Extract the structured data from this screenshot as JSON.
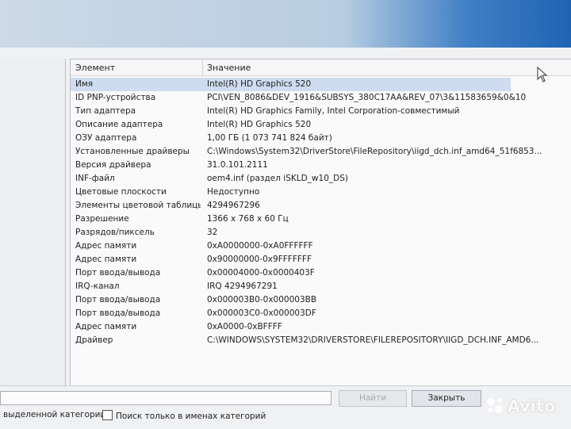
{
  "list": {
    "col_element": "Элемент",
    "col_value": "Значение",
    "rows": [
      {
        "name": "Имя",
        "value": "Intel(R) HD Graphics 520"
      },
      {
        "name": "ID PNP-устройства",
        "value": "PCI\\VEN_8086&DEV_1916&SUBSYS_380C17AA&REV_07\\3&11583659&0&10"
      },
      {
        "name": "Тип адаптера",
        "value": "Intel(R) HD Graphics Family, Intel Corporation-совместимый"
      },
      {
        "name": "Описание адаптера",
        "value": "Intel(R) HD Graphics 520"
      },
      {
        "name": "ОЗУ адаптера",
        "value": "1,00 ГБ (1 073 741 824 байт)"
      },
      {
        "name": "Установленные драйверы",
        "value": "C:\\Windows\\System32\\DriverStore\\FileRepository\\iigd_dch.inf_amd64_51f6853..."
      },
      {
        "name": "Версия драйвера",
        "value": "31.0.101.2111"
      },
      {
        "name": "INF-файл",
        "value": "oem4.inf (раздел iSKLD_w10_DS)"
      },
      {
        "name": "Цветовые плоскости",
        "value": "Недоступно"
      },
      {
        "name": "Элементы цветовой таблицы",
        "value": "4294967296"
      },
      {
        "name": "Разрешение",
        "value": "1366 x 768 x 60 Гц"
      },
      {
        "name": "Разрядов/пиксель",
        "value": "32"
      },
      {
        "name": "Адрес памяти",
        "value": "0xA0000000-0xA0FFFFFF"
      },
      {
        "name": "Адрес памяти",
        "value": "0x90000000-0x9FFFFFFF"
      },
      {
        "name": "Порт ввода/вывода",
        "value": "0x00004000-0x0000403F"
      },
      {
        "name": "IRQ-канал",
        "value": "IRQ 4294967291"
      },
      {
        "name": "Порт ввода/вывода",
        "value": "0x000003B0-0x000003BB"
      },
      {
        "name": "Порт ввода/вывода",
        "value": "0x000003C0-0x000003DF"
      },
      {
        "name": "Адрес памяти",
        "value": "0xA0000-0xBFFFF"
      },
      {
        "name": "Драйвер",
        "value": "C:\\WINDOWS\\SYSTEM32\\DRIVERSTORE\\FILEREPOSITORY\\IIGD_DCH.INF_AMD6..."
      }
    ]
  },
  "search": {
    "value": "",
    "find_label": "Найти",
    "close_label": "Закрыть",
    "selected_category_label": "выделенной категории",
    "category_names_label": "Поиск только в именах категорий"
  },
  "watermark": {
    "text": "Avito"
  },
  "colors": {
    "selection": "#cfdcf0",
    "accent_blue": "#1f63b4"
  }
}
